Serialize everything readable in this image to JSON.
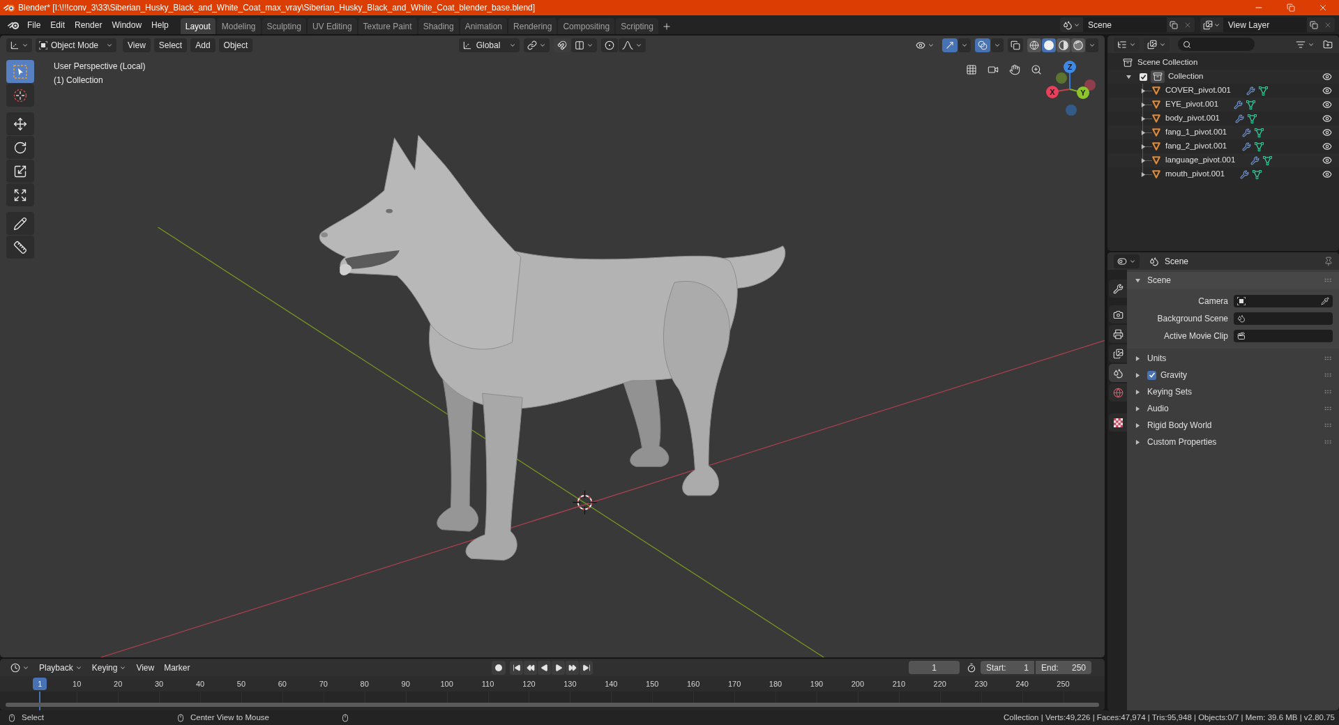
{
  "window": {
    "title": "Blender* [I:\\!!!conv_3\\33\\Siberian_Husky_Black_and_White_Coat_max_vray\\Siberian_Husky_Black_and_White_Coat_blender_base.blend]"
  },
  "menu": [
    "File",
    "Edit",
    "Render",
    "Window",
    "Help"
  ],
  "workspaces": [
    {
      "label": "Layout",
      "selected": true
    },
    {
      "label": "Modeling",
      "selected": false
    },
    {
      "label": "Sculpting",
      "selected": false
    },
    {
      "label": "UV Editing",
      "selected": false
    },
    {
      "label": "Texture Paint",
      "selected": false
    },
    {
      "label": "Shading",
      "selected": false
    },
    {
      "label": "Animation",
      "selected": false
    },
    {
      "label": "Rendering",
      "selected": false
    },
    {
      "label": "Compositing",
      "selected": false
    },
    {
      "label": "Scripting",
      "selected": false
    }
  ],
  "scene": {
    "value": "Scene"
  },
  "view_layer": {
    "value": "View Layer"
  },
  "viewport": {
    "mode": "Object Mode",
    "menus": [
      "View",
      "Select",
      "Add",
      "Object"
    ],
    "orientation": "Global",
    "overlay_text": [
      "User Perspective (Local)",
      "(1) Collection"
    ],
    "toggles": [
      {
        "kind": "gizmos",
        "on": true
      },
      {
        "kind": "overlays",
        "on": true
      },
      {
        "kind": "xray",
        "on": false
      }
    ],
    "shading": [
      {
        "kind": "wireframe",
        "selected": false
      },
      {
        "kind": "solid",
        "selected": true
      },
      {
        "kind": "material",
        "selected": false
      },
      {
        "kind": "rendered",
        "selected": false
      }
    ],
    "tools": [
      {
        "kind": "select_box",
        "selected": true
      },
      {
        "kind": "cursor",
        "selected": false
      },
      {
        "kind": "move",
        "selected": false
      },
      {
        "kind": "rotate",
        "selected": false
      },
      {
        "kind": "scale",
        "selected": false
      },
      {
        "kind": "transform",
        "selected": false
      },
      {
        "kind": "annotate",
        "selected": false
      },
      {
        "kind": "measure",
        "selected": false
      }
    ],
    "gizmo_axes": [
      {
        "label": "X",
        "color": "#e8405a"
      },
      {
        "label": "Y",
        "color": "#8dc62b"
      },
      {
        "label": "Z",
        "color": "#3d8ae6"
      }
    ]
  },
  "outliner": {
    "root": "Scene Collection",
    "collections": [
      {
        "label": "Collection",
        "checked": true,
        "expanded": true,
        "children": [
          {
            "label": "COVER_pivot.001",
            "expanded": false
          },
          {
            "label": "EYE_pivot.001",
            "expanded": false
          },
          {
            "label": "body_pivot.001",
            "expanded": false
          },
          {
            "label": "fang_1_pivot.001",
            "expanded": false
          },
          {
            "label": "fang_2_pivot.001",
            "expanded": false
          },
          {
            "label": "language_pivot.001",
            "expanded": false
          },
          {
            "label": "mouth_pivot.001",
            "expanded": false
          }
        ]
      }
    ]
  },
  "properties": {
    "context": "Scene",
    "tabs": [
      {
        "kind": "tool",
        "selected": false
      },
      {
        "kind": "render",
        "selected": false
      },
      {
        "kind": "output",
        "selected": false
      },
      {
        "kind": "view_layer",
        "selected": false
      },
      {
        "kind": "scene",
        "selected": true
      },
      {
        "kind": "world",
        "selected": false
      },
      {
        "kind": "texture",
        "selected": false
      }
    ],
    "panels": [
      {
        "kind": "section",
        "label": "Scene",
        "expanded": true,
        "fields": [
          {
            "kind": "camera",
            "label": "Camera"
          },
          {
            "kind": "scene",
            "label": "Background Scene"
          },
          {
            "kind": "clip",
            "label": "Active Movie Clip"
          }
        ]
      },
      {
        "kind": "section",
        "label": "Units",
        "expanded": false
      },
      {
        "kind": "toggle",
        "label": "Gravity",
        "expanded": false,
        "checked": true
      },
      {
        "kind": "section",
        "label": "Keying Sets",
        "expanded": false
      },
      {
        "kind": "section",
        "label": "Audio",
        "expanded": false
      },
      {
        "kind": "section",
        "label": "Rigid Body World",
        "expanded": false
      },
      {
        "kind": "section",
        "label": "Custom Properties",
        "expanded": false
      }
    ]
  },
  "timeline": {
    "menus": [
      "Playback",
      "Keying",
      "View",
      "Marker"
    ],
    "current_frame": "1",
    "start_label": "Start:",
    "start": "1",
    "end_label": "End:",
    "end": "250",
    "playhead": "1",
    "ticks": [
      "10",
      "20",
      "30",
      "40",
      "50",
      "60",
      "70",
      "80",
      "90",
      "100",
      "110",
      "120",
      "130",
      "140",
      "150",
      "160",
      "170",
      "180",
      "190",
      "200",
      "210",
      "220",
      "230",
      "240",
      "250"
    ]
  },
  "status_bar": {
    "hints": [
      "Select",
      "Center View to Mouse"
    ],
    "stats": "Collection | Verts:49,226 | Faces:47,974 | Tris:95,948 | Objects:0/7 | Mem: 39.6 MB | v2.80.75"
  }
}
